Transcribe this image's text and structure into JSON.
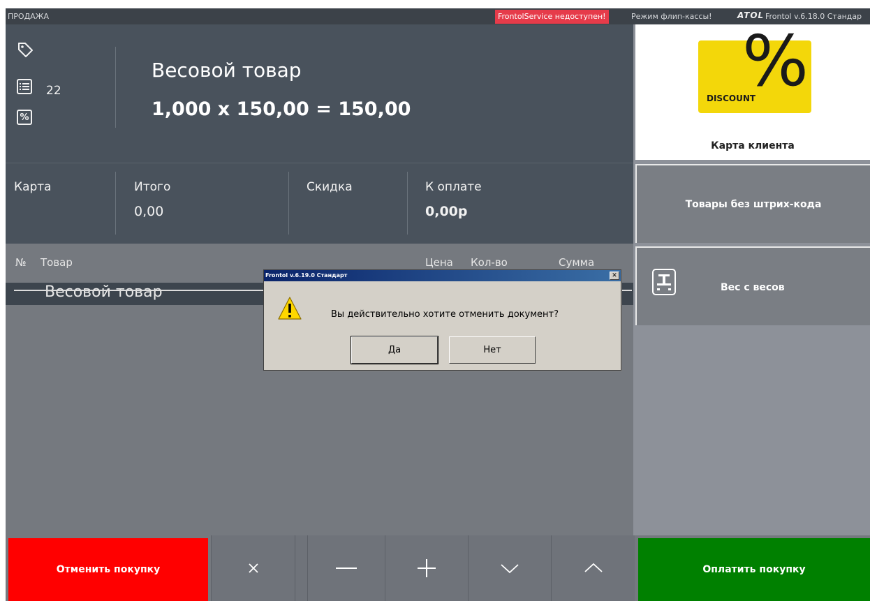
{
  "topbar": {
    "mode": "ПРОДАЖА",
    "alert": "FrontolService недоступен!",
    "flip_mode": "Режим флип-кассы!",
    "logo": "ATOL",
    "version": "Frontol v.6.18.0 Стандар"
  },
  "current_item": {
    "name": "Весовой товар",
    "calc": "1,000 x 150,00 = 150,00",
    "position_count": "22"
  },
  "totals": {
    "card_label": "Карта",
    "total_label": "Итого",
    "total_value": "0,00",
    "discount_label": "Скидка",
    "to_pay_label": "К оплате",
    "to_pay_value": "0,00р"
  },
  "receipt": {
    "columns": {
      "num": "№",
      "item": "Товар",
      "price": "Цена",
      "qty": "Кол-во",
      "sum": "Сумма"
    },
    "rows": [
      {
        "name": "Весовой товар"
      }
    ]
  },
  "right_panel": {
    "discount_badge": "DISCOUNT",
    "discount_symbol": "%",
    "client_card": "Карта клиента",
    "no_barcode": "Товары без штрих-кода",
    "scales": "Вес с весов"
  },
  "bottom": {
    "cancel": "Отменить покупку",
    "pay": "Оплатить покупку"
  },
  "dialog": {
    "title": "Frontol v.6.19.0 Стандарт",
    "message": "Вы действительно хотите отменить документ?",
    "yes": "Да",
    "no": "Нет"
  },
  "colors": {
    "cancel": "#ff0000",
    "pay": "#008000",
    "alert": "#e63b4a",
    "discount": "#f3d70a",
    "panel": "#49525c"
  }
}
